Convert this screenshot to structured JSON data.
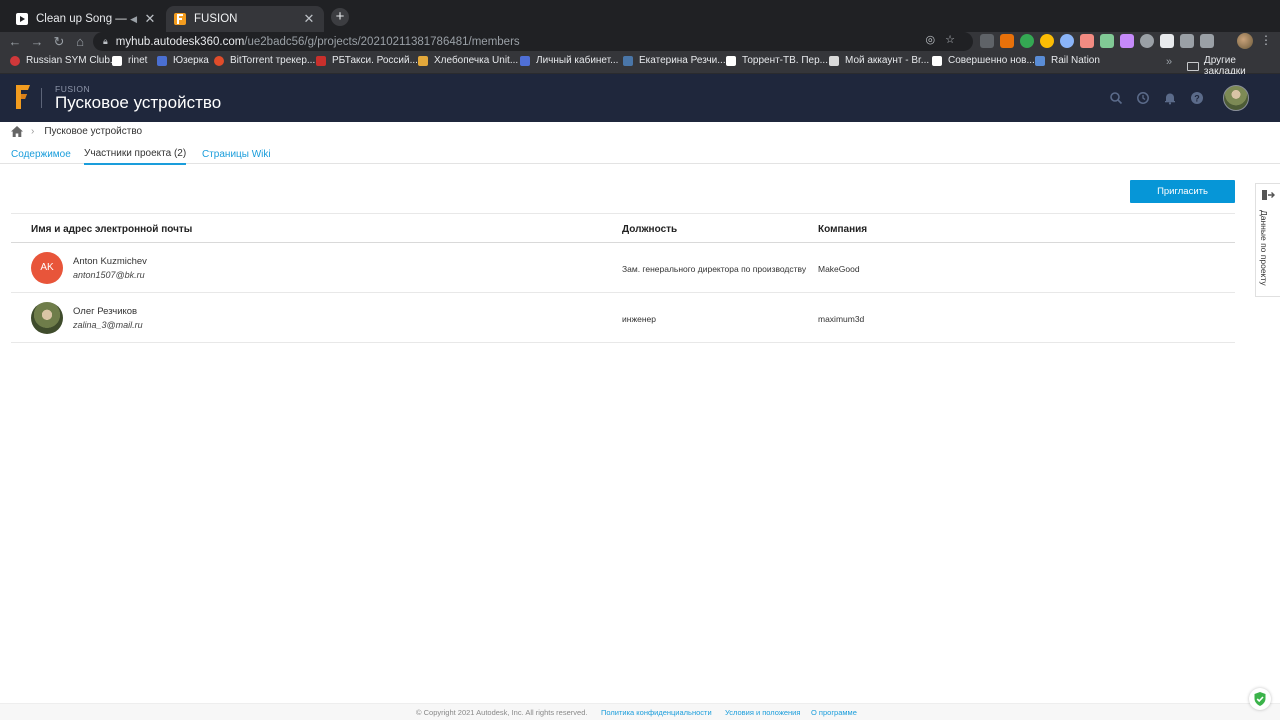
{
  "browser": {
    "tabs": [
      {
        "title": "Clean up Song — Martik C",
        "active": false
      },
      {
        "title": "FUSION",
        "active": true
      }
    ],
    "url_host": "myhub.autodesk360.com",
    "url_path": "/ue2badc56/g/projects/20210211381786481/members",
    "bookmarks": [
      {
        "label": "Russian SYM Club...",
        "color": "#d0383a"
      },
      {
        "label": "rinet",
        "color": "#ffffff"
      },
      {
        "label": "Юзерка",
        "color": "#4a6fd1"
      },
      {
        "label": "BitTorrent трекер...",
        "color": "#e04c2a"
      },
      {
        "label": "РБТакси. Россий...",
        "color": "#c9302c"
      },
      {
        "label": "Хлебопечка Unit...",
        "color": "#e3a83b"
      },
      {
        "label": "Личный кабинет...",
        "color": "#4f6fd6"
      },
      {
        "label": "Екатерина Резчи...",
        "color": "#4a76a8"
      },
      {
        "label": "Торрент-ТВ. Пер...",
        "color": "#ffffff"
      },
      {
        "label": "Мой аккаунт - Br...",
        "color": "#d9d9d9"
      },
      {
        "label": "Совершенно нов...",
        "color": "#ffffff"
      },
      {
        "label": "Rail Nation",
        "color": "#5a8dd6"
      }
    ],
    "other_bookmarks": "Другие закладки"
  },
  "app": {
    "product": "FUSION",
    "project_name": "Пусковое устройство",
    "brand_color": "#f29c1f",
    "header_bg": "#1f273c"
  },
  "breadcrumb": {
    "project": "Пусковое устройство"
  },
  "tabs": [
    {
      "label": "Содержимое",
      "active": false
    },
    {
      "label": "Участники проекта (2)",
      "active": true
    },
    {
      "label": "Страницы Wiki",
      "active": false
    }
  ],
  "invite_label": "Пригласить",
  "side_panel_label": "Данные по проекту",
  "table": {
    "headers": {
      "name": "Имя и адрес электронной почты",
      "role": "Должность",
      "company": "Компания"
    },
    "rows": [
      {
        "initials": "AK",
        "avatar_color": "#e8553a",
        "name": "Anton Kuzmichev",
        "email": "anton1507@bk.ru",
        "role": "Зам. генерального директора по производству",
        "company": "MakeGood"
      },
      {
        "initials": "",
        "avatar_color": "",
        "name": "Олег Резчиков",
        "email": "zalina_3@mail.ru",
        "role": "инженер",
        "company": "maximum3d"
      }
    ]
  },
  "footer": {
    "copyright": "© Copyright 2021 Autodesk, Inc. All rights reserved.",
    "links": [
      "Политика конфиденциальности",
      "Условия и положения",
      "О программе"
    ]
  }
}
